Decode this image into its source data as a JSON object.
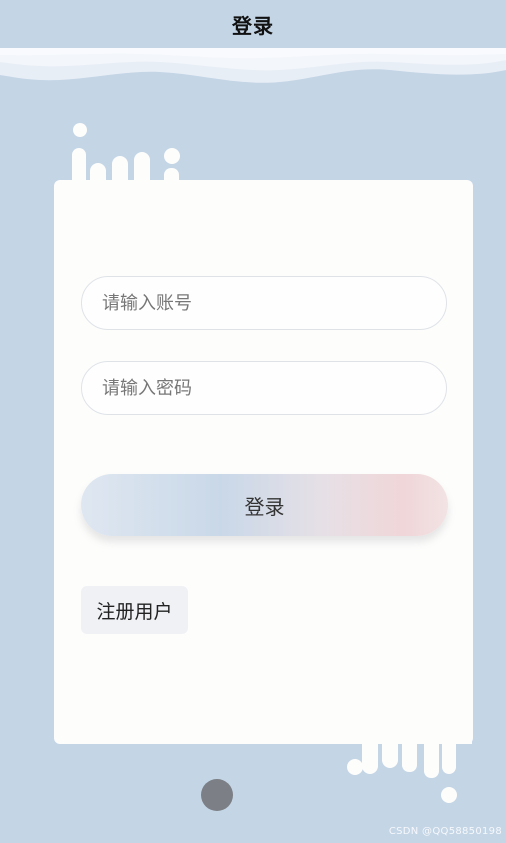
{
  "header": {
    "title": "登录"
  },
  "form": {
    "account_placeholder": "请输入账号",
    "password_placeholder": "请输入密码",
    "login_label": "登录",
    "register_label": "注册用户"
  },
  "watermark": "CSDN @QQ58850198",
  "colors": {
    "background": "#c4d5e6",
    "card": "#fdfdfc",
    "home_button": "#7c7f85"
  }
}
